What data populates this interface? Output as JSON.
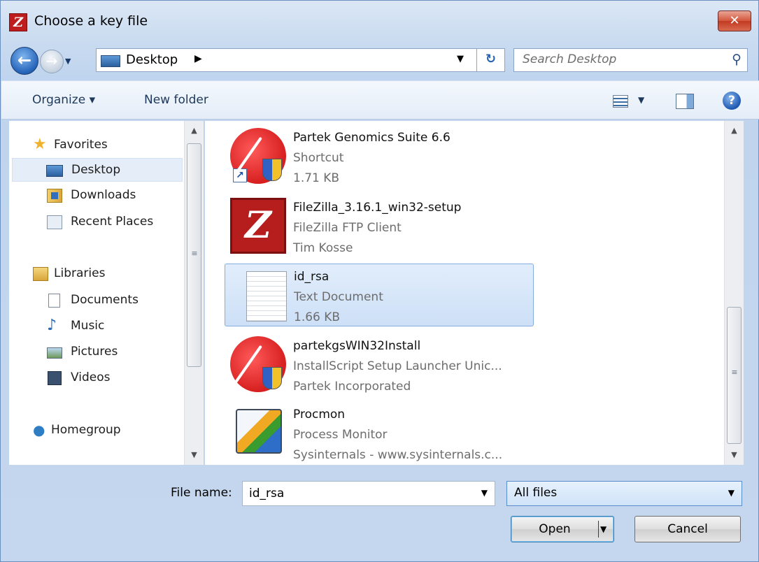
{
  "window": {
    "title": "Choose a key file",
    "app_icon": "Z",
    "close": "✕"
  },
  "address": {
    "location": "Desktop",
    "search_placeholder": "Search Desktop"
  },
  "toolbar": {
    "organize": "Organize ▾",
    "new_folder": "New folder"
  },
  "nav": {
    "favorites": "Favorites",
    "desktop": "Desktop",
    "downloads": "Downloads",
    "recent": "Recent Places",
    "libraries": "Libraries",
    "documents": "Documents",
    "music": "Music",
    "pictures": "Pictures",
    "videos": "Videos",
    "homegroup": "Homegroup"
  },
  "files": [
    {
      "name": "Partek Genomics Suite 6.6",
      "type": "Shortcut",
      "detail": "1.71 KB",
      "icon": "partek-shortcut-icon"
    },
    {
      "name": "FileZilla_3.16.1_win32-setup",
      "type": "FileZilla FTP Client",
      "detail": "Tim Kosse",
      "icon": "filezilla-icon"
    },
    {
      "name": "id_rsa",
      "type": "Text Document",
      "detail": "1.66 KB",
      "icon": "text-document-icon"
    },
    {
      "name": "partekgsWIN32Install",
      "type": "InstallScript Setup Launcher Unic...",
      "detail": "Partek Incorporated",
      "icon": "partek-installer-icon"
    },
    {
      "name": "Procmon",
      "type": "Process Monitor",
      "detail": "Sysinternals - www.sysinternals.c...",
      "icon": "procmon-icon"
    }
  ],
  "bottom": {
    "file_name_label": "File name:",
    "file_name_value": "id_rsa",
    "filter_value": "All files",
    "open_label": "Open",
    "cancel_label": "Cancel"
  },
  "colors": {
    "accent": "#3c7fb1",
    "selection": "#cde0f7"
  }
}
